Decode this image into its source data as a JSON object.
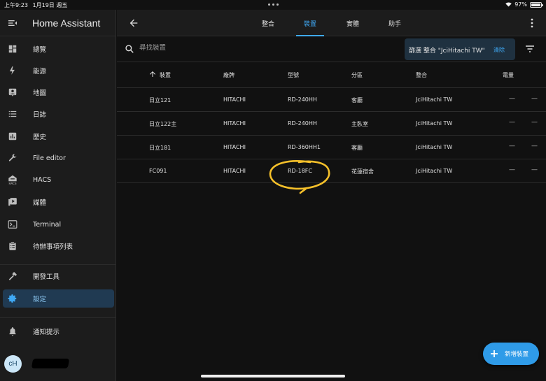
{
  "statusbar": {
    "time": "上午9:23",
    "date": "1月19日 週五",
    "battery": "97%",
    "battery_level": 0.97
  },
  "sidebar": {
    "title": "Home Assistant",
    "items": [
      {
        "label": "總覽",
        "icon": "dashboard-icon"
      },
      {
        "label": "能源",
        "icon": "lightning-icon"
      },
      {
        "label": "地圖",
        "icon": "map-person-icon"
      },
      {
        "label": "日誌",
        "icon": "list-icon"
      },
      {
        "label": "歷史",
        "icon": "chart-icon"
      },
      {
        "label": "File editor",
        "icon": "wrench-icon"
      },
      {
        "label": "HACS",
        "icon": "hacs-icon"
      },
      {
        "label": "媒體",
        "icon": "media-icon"
      },
      {
        "label": "Terminal",
        "icon": "terminal-icon"
      },
      {
        "label": "待辦事項列表",
        "icon": "clipboard-icon"
      }
    ],
    "dev_tools": "開發工具",
    "settings": "設定",
    "notifications": "通知提示",
    "avatar": "cH"
  },
  "tabs": [
    {
      "label": "整合"
    },
    {
      "label": "裝置"
    },
    {
      "label": "實體"
    },
    {
      "label": "助手"
    }
  ],
  "search": {
    "placeholder": "尋找裝置"
  },
  "filter": {
    "label": "篩選 整合 \"JciHitachi TW\"",
    "clear": "清除"
  },
  "table": {
    "columns": [
      "裝置",
      "廠牌",
      "型號",
      "分區",
      "整合",
      "電量"
    ],
    "rows": [
      {
        "device": "日立121",
        "manufacturer": "HITACHI",
        "model": "RD-240HH",
        "area": "客廳",
        "integration": "JciHitachi TW",
        "battery": "—",
        "extra": "—"
      },
      {
        "device": "日立122主",
        "manufacturer": "HITACHI",
        "model": "RD-240HH",
        "area": "主臥室",
        "integration": "JciHitachi TW",
        "battery": "—",
        "extra": "—"
      },
      {
        "device": "日立181",
        "manufacturer": "HITACHI",
        "model": "RD-360HH1",
        "area": "客廳",
        "integration": "JciHitachi TW",
        "battery": "—",
        "extra": "—"
      },
      {
        "device": "FC091",
        "manufacturer": "HITACHI",
        "model": "RD-18FC",
        "area": "花蓮宿舍",
        "integration": "JciHitachi TW",
        "battery": "—",
        "extra": "—"
      }
    ]
  },
  "fab": {
    "label": "新增裝置"
  },
  "colors": {
    "accent": "#3fa9f5",
    "annotation": "#f5c02a",
    "active_bg": "#203a52"
  }
}
